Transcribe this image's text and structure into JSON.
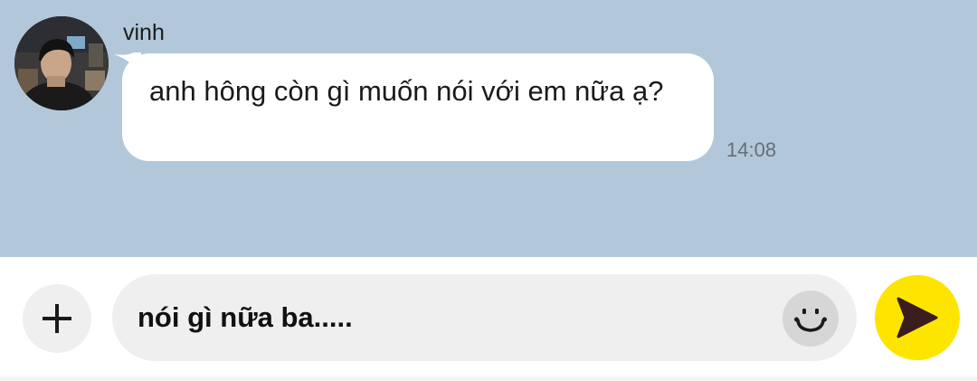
{
  "conversation": {
    "message": {
      "sender": "vinh",
      "text": "anh hông còn gì muốn nói với em nữa ạ?",
      "time": "14:08",
      "avatar_icon": "profile-photo"
    }
  },
  "composer": {
    "plus_icon": "plus-icon",
    "input_value": "nói gì nữa ba.....",
    "emoji_icon": "smiley-icon",
    "send_icon": "send-arrow-icon"
  },
  "colors": {
    "chat_background": "#b2c7da",
    "bubble": "#ffffff",
    "send_button": "#fee500",
    "input_background": "#efefef"
  }
}
